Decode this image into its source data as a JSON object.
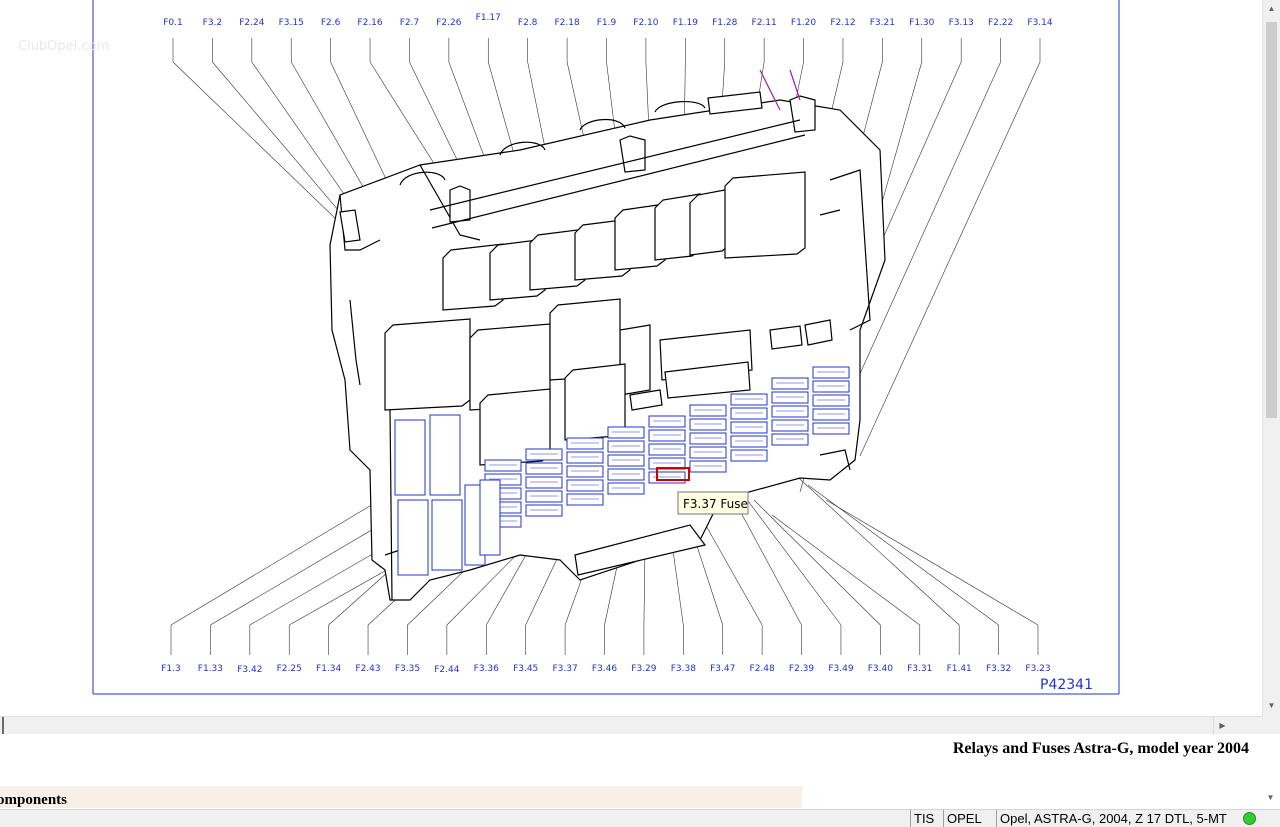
{
  "diagram": {
    "top_labels": [
      "F0.1",
      "F3.2",
      "F2.24",
      "F3.15",
      "F2.6",
      "F2.16",
      "F2.7",
      "F2.26",
      "F1.17",
      "F2.8",
      "F2.18",
      "F1.9",
      "F2.10",
      "F1.19",
      "F1.28",
      "F2.11",
      "F1.20",
      "F2.12",
      "F3.21",
      "F1.30",
      "F3.13",
      "F2.22",
      "F3.14"
    ],
    "bottom_labels": [
      "F1.3",
      "F1.33",
      "F3.42",
      "F2.25",
      "F1.34",
      "F2.43",
      "F3.35",
      "F2.44",
      "F3.36",
      "F3.45",
      "F3.37",
      "F3.46",
      "F3.29",
      "F3.38",
      "F3.47",
      "F2.48",
      "F2.39",
      "F3.49",
      "F3.40",
      "F3.31",
      "F1.41",
      "F3.32",
      "F3.23"
    ],
    "reference": "P42341",
    "tooltip": "F3.37 Fuse",
    "watermark": "ClubOpel.com",
    "line_color": "#2233cc",
    "highlight_color": "#cc0000"
  },
  "caption": "Relays and Fuses Astra-G, model year 2004",
  "components_heading": "omponents",
  "statusbar": {
    "app": "TIS",
    "make": "OPEL",
    "vehicle": "Opel, ASTRA-G, 2004, Z 17 DTL, 5-MT",
    "status_color": "#33cc33"
  }
}
